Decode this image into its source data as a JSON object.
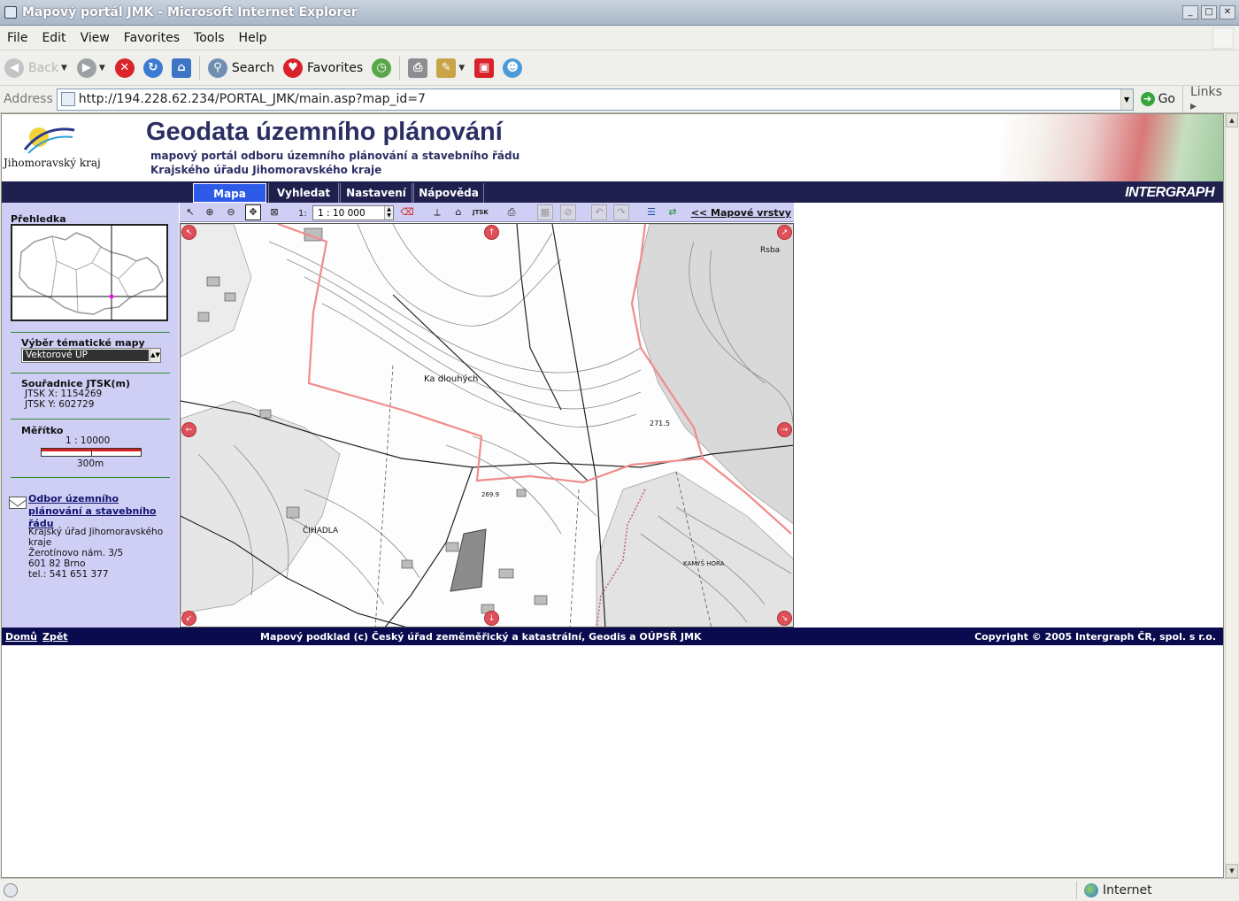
{
  "window": {
    "title": "Mapový portál JMK - Microsoft Internet Explorer",
    "min": "_",
    "max": "□",
    "close": "✕"
  },
  "menu": [
    "File",
    "Edit",
    "View",
    "Favorites",
    "Tools",
    "Help"
  ],
  "toolbar": {
    "back": "Back",
    "search": "Search",
    "favorites": "Favorites"
  },
  "address": {
    "label": "Address",
    "url": "http://194.228.62.234/PORTAL_JMK/main.asp?map_id=7",
    "go": "Go",
    "links": "Links"
  },
  "header": {
    "logo_text": "Jihomoravský kraj",
    "title": "Geodata územního plánování",
    "subtitle1": "mapový portál odboru územního plánování a stavebního řádu",
    "subtitle2": "Krajského úřadu Jihomoravského kraje"
  },
  "nav": {
    "tabs": [
      "Mapa",
      "Vyhledat",
      "Nastavení",
      "Nápověda"
    ],
    "active": "Mapa",
    "brand": "INTERGRAPH"
  },
  "left_panel": {
    "overview_label": "Přehledka",
    "theme_label": "Výběr tématické mapy",
    "theme_value": "Vektorové ÚP",
    "coords_label": "Souřadnice JTSK(m)",
    "coord_x": "JTSK X: 1154269",
    "coord_y": "JTSK Y: 602729",
    "scale_label": "Měřítko",
    "scale_value": "1 : 10000",
    "scale_bar_text": "300m",
    "contact_link": "Odbor územního plánování a stavebního řádu",
    "contact_address": "Krajský úřad Jihomoravského kraje\nŽerotínovo nám. 3/5\n601 82 Brno\ntel.: 541 651 377"
  },
  "map_toolbar": {
    "scale_prefix": "1:",
    "scale_value": "1 : 10 000",
    "jtsk": "JTSK",
    "layers_link": "<< Mapové vrstvy"
  },
  "map": {
    "labels": [
      "Ka dlouhých",
      "ČIHADLA",
      "Rsba",
      "271.5",
      "269.9",
      "KAMÝŠ HORA"
    ]
  },
  "footer": {
    "home": "Domů",
    "back": "Zpět",
    "center": "Mapový podklad (c) Český úřad zeměměřický a katastrální, Geodis a OÚPSŘ JMK",
    "copyright": "Copyright © 2005 Intergraph ČR, spol. s r.o."
  },
  "status": {
    "zone": "Internet"
  },
  "colors": {
    "navy": "#20204f",
    "panel": "#cfcff5",
    "active_tab": "#2d5ae8",
    "title": "#2c2f63"
  }
}
